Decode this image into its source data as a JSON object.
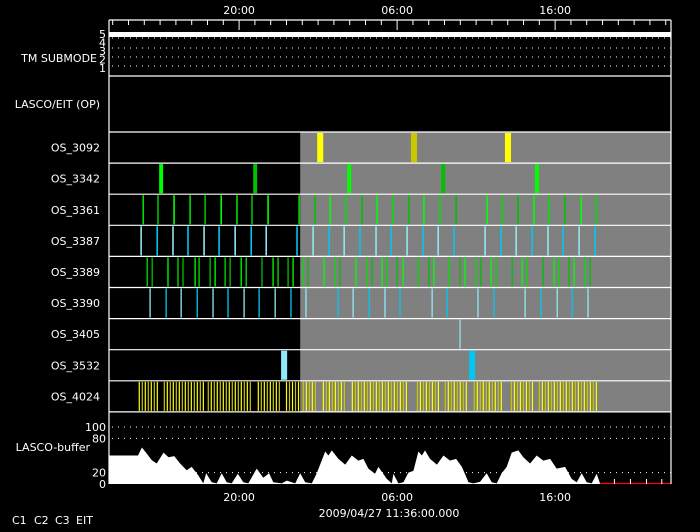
{
  "chart_data": {
    "type": "timeline",
    "axis": {
      "start": "04-26 11:46",
      "end": "04-27 23:20",
      "tick_labels": [
        {
          "t": "04-26 20:00",
          "label": "20:00"
        },
        {
          "t": "04-27 06:00",
          "label": "06:00"
        },
        {
          "t": "04-27 16:00",
          "label": "16:00"
        }
      ],
      "minor_tick_interval": "1 hour"
    },
    "current_time": "2009/04/27 11:36:00.000",
    "shaded_from": "04-26 23:52",
    "shade_color": "#808080",
    "tm_submode": {
      "label": "TM SUBMODE",
      "levels": [
        "5",
        "4",
        "3",
        "2",
        "1"
      ],
      "value": 5
    },
    "lasco_eit": {
      "label": "LASCO/EIT (OP)"
    },
    "rows": [
      {
        "label": "OS_3092",
        "dur": 23,
        "colors": [
          "#ffff00",
          "#c8c800",
          "#ffff00"
        ],
        "times": [
          "04-27 01:08",
          "04-27 07:04",
          "04-27 13:01"
        ]
      },
      {
        "label": "OS_3342",
        "dur": 15,
        "colors": [
          "#00ff00",
          "#00c000"
        ],
        "times": [
          "04-26 15:04",
          "04-26 21:01",
          "04-27 02:58",
          "04-27 08:55",
          "04-27 14:51"
        ]
      },
      {
        "label": "OS_3361",
        "dur": 6,
        "colors": [
          "#00e000",
          "#00c000",
          "#00ff00"
        ],
        "times": [
          "04-26 13:56",
          "04-26 14:52",
          "04-26 15:53",
          "04-26 16:54",
          "04-26 17:51",
          "04-26 18:52",
          "04-26 19:52",
          "04-26 20:49",
          "04-26 21:50",
          "04-26 23:48",
          "04-27 00:49",
          "04-27 01:46",
          "04-27 02:46",
          "04-27 03:47",
          "04-27 04:44",
          "04-27 05:45",
          "04-27 06:45",
          "04-27 07:42",
          "04-27 08:43",
          "04-27 09:44",
          "04-27 11:42",
          "04-27 12:39",
          "04-27 13:39",
          "04-27 14:40",
          "04-27 15:37",
          "04-27 16:38",
          "04-27 17:39",
          "04-27 18:36"
        ]
      },
      {
        "label": "OS_3387",
        "dur": 6,
        "colors": [
          "#90e8f8",
          "#00c8f0"
        ],
        "times": [
          "04-26 13:48",
          "04-26 14:49",
          "04-26 15:49",
          "04-26 16:46",
          "04-26 17:47",
          "04-26 18:44",
          "04-26 19:45",
          "04-26 20:46",
          "04-26 21:43",
          "04-26 23:40",
          "04-27 00:41",
          "04-27 01:42",
          "04-27 02:39",
          "04-27 03:39",
          "04-27 04:40",
          "04-27 05:37",
          "04-27 06:38",
          "04-27 07:39",
          "04-27 08:36",
          "04-27 09:36",
          "04-27 11:34",
          "04-27 12:35",
          "04-27 13:32",
          "04-27 14:33",
          "04-27 15:33",
          "04-27 16:30",
          "04-27 17:31",
          "04-27 18:32"
        ]
      },
      {
        "label": "OS_3389",
        "dur": 5,
        "colors": [
          "#00e000",
          "#00c000",
          "#00ff00"
        ],
        "times": [
          "04-26 14:11",
          "04-26 14:30",
          "04-26 15:30",
          "04-26 16:08",
          "04-26 16:27",
          "04-26 17:13",
          "04-26 17:28",
          "04-26 18:10",
          "04-26 18:29",
          "04-26 19:07",
          "04-26 19:26",
          "04-26 20:08",
          "04-26 20:27",
          "04-26 21:27",
          "04-26 22:09",
          "04-26 22:28",
          "04-26 23:06",
          "04-26 23:25",
          "04-27 00:03",
          "04-27 00:22",
          "04-27 01:23",
          "04-27 02:05",
          "04-27 02:23",
          "04-27 03:24",
          "04-27 04:06",
          "04-27 04:25",
          "04-27 05:03",
          "04-27 05:22",
          "04-27 06:00",
          "04-27 06:23",
          "04-27 07:20",
          "04-27 08:01",
          "04-27 08:20",
          "04-27 09:17",
          "04-27 09:59",
          "04-27 10:18",
          "04-27 11:00",
          "04-27 11:19",
          "04-27 11:57",
          "04-27 12:16",
          "04-27 13:17",
          "04-27 13:55",
          "04-27 14:14",
          "04-27 15:14",
          "04-27 15:56",
          "04-27 16:15",
          "04-27 16:53",
          "04-27 17:12",
          "04-27 17:54",
          "04-27 18:13"
        ]
      },
      {
        "label": "OS_3390",
        "dur": 5,
        "colors": [
          "#90e8f8",
          "#00c8f0"
        ],
        "times": [
          "04-26 14:22",
          "04-26 15:23",
          "04-26 16:20",
          "04-26 17:21",
          "04-26 18:21",
          "04-26 19:18",
          "04-26 20:19",
          "04-26 21:16",
          "04-26 22:17",
          "04-26 23:17",
          "04-27 00:14",
          "04-27 02:16",
          "04-27 03:13",
          "04-27 04:14",
          "04-27 05:14",
          "04-27 06:11",
          "04-27 08:13",
          "04-27 09:10",
          "04-27 11:07",
          "04-27 12:08",
          "04-27 14:06",
          "04-27 15:07",
          "04-27 16:08",
          "04-27 17:05",
          "04-27 18:05"
        ]
      },
      {
        "label": "OS_3405",
        "dur": 4,
        "colors": [
          "#90e8f8"
        ],
        "times": [
          "04-27 09:59"
        ]
      },
      {
        "label": "OS_3532",
        "dur": 23,
        "colors": [
          "#90e8f8",
          "#00c8f0"
        ],
        "times": [
          "04-26 22:51",
          "04-27 10:45"
        ]
      },
      {
        "label": "OS_4024",
        "dur": 3,
        "colors": [
          "#ffff00",
          "#c8c800"
        ],
        "segments": [
          {
            "start": "04-26 13:41",
            "interval_min": 11.4,
            "count": 7
          },
          {
            "start": "04-26 15:16",
            "interval_min": 11.4,
            "count": 14
          },
          {
            "start": "04-26 18:03",
            "interval_min": 11.4,
            "count": 15
          },
          {
            "start": "04-26 21:13",
            "interval_min": 11.4,
            "count": 8
          },
          {
            "start": "04-26 23:00",
            "interval_min": 11.4,
            "count": 5
          },
          {
            "start": "04-27 00:04",
            "interval_min": 11.4,
            "count": 5
          },
          {
            "start": "04-27 01:20",
            "interval_min": 11.4,
            "count": 8
          },
          {
            "start": "04-27 03:10",
            "interval_min": 11.4,
            "count": 19
          },
          {
            "start": "04-27 07:17",
            "interval_min": 11.4,
            "count": 8
          },
          {
            "start": "04-27 09:03",
            "interval_min": 11.4,
            "count": 8
          },
          {
            "start": "04-27 10:53",
            "interval_min": 11.4,
            "count": 10
          },
          {
            "start": "04-27 13:14",
            "interval_min": 11.4,
            "count": 8
          },
          {
            "start": "04-27 15:00",
            "interval_min": 11.4,
            "count": 20
          }
        ]
      }
    ],
    "buffer": {
      "label": "LASCO-buffer",
      "ylim": [
        0,
        100
      ],
      "yticks": [
        "100",
        "80",
        "20",
        "0"
      ],
      "grid_values": [
        100,
        80,
        20
      ],
      "baseline_color": "#ff0000",
      "baseline_from": "04-27 18:51",
      "baseline_ticks": [
        "04-27 19:45",
        "04-27 20:46",
        "04-27 21:47",
        "04-27 22:45"
      ],
      "points": [
        [
          "04-26 11:46",
          50
        ],
        [
          "04-26 13:36",
          50
        ],
        [
          "04-26 13:51",
          64
        ],
        [
          "04-26 14:10",
          53
        ],
        [
          "04-26 14:28",
          42
        ],
        [
          "04-26 14:47",
          36
        ],
        [
          "04-26 15:13",
          55
        ],
        [
          "04-26 15:32",
          47
        ],
        [
          "04-26 15:54",
          49
        ],
        [
          "04-26 16:16",
          36
        ],
        [
          "04-26 16:41",
          24
        ],
        [
          "04-26 17:00",
          30
        ],
        [
          "04-26 17:25",
          15
        ],
        [
          "04-26 17:44",
          1
        ],
        [
          "04-26 17:55",
          19
        ],
        [
          "04-26 18:16",
          3
        ],
        [
          "04-26 18:35",
          1
        ],
        [
          "04-26 18:54",
          19
        ],
        [
          "04-26 19:13",
          3
        ],
        [
          "04-26 19:32",
          1
        ],
        [
          "04-26 19:55",
          18
        ],
        [
          "04-26 20:16",
          3
        ],
        [
          "04-26 20:35",
          1
        ],
        [
          "04-26 21:07",
          27
        ],
        [
          "04-26 21:32",
          11
        ],
        [
          "04-26 21:54",
          19
        ],
        [
          "04-26 22:10",
          3
        ],
        [
          "04-26 22:42",
          1
        ],
        [
          "04-26 23:01",
          6
        ],
        [
          "04-26 23:33",
          1
        ],
        [
          "04-26 23:52",
          19
        ],
        [
          "04-27 00:11",
          3
        ],
        [
          "04-27 00:36",
          1
        ],
        [
          "04-27 00:55",
          19
        ],
        [
          "04-27 01:27",
          57
        ],
        [
          "04-27 01:39",
          50
        ],
        [
          "04-27 01:52",
          59
        ],
        [
          "04-27 02:17",
          44
        ],
        [
          "04-27 02:43",
          34
        ],
        [
          "04-27 03:08",
          50
        ],
        [
          "04-27 03:33",
          41
        ],
        [
          "04-27 03:52",
          44
        ],
        [
          "04-27 04:11",
          27
        ],
        [
          "04-27 04:36",
          18
        ],
        [
          "04-27 04:49",
          30
        ],
        [
          "04-27 05:21",
          9
        ],
        [
          "04-27 05:40",
          1
        ],
        [
          "04-27 05:46",
          18
        ],
        [
          "04-27 06:05",
          1
        ],
        [
          "04-27 06:24",
          3
        ],
        [
          "04-27 06:43",
          20
        ],
        [
          "04-27 07:02",
          23
        ],
        [
          "04-27 07:21",
          57
        ],
        [
          "04-27 07:34",
          50
        ],
        [
          "04-27 07:46",
          59
        ],
        [
          "04-27 08:05",
          44
        ],
        [
          "04-27 08:31",
          34
        ],
        [
          "04-27 08:56",
          50
        ],
        [
          "04-27 09:21",
          41
        ],
        [
          "04-27 09:44",
          44
        ],
        [
          "04-27 10:06",
          30
        ],
        [
          "04-27 10:31",
          3
        ],
        [
          "04-27 10:50",
          1
        ],
        [
          "04-27 11:15",
          4
        ],
        [
          "04-27 11:40",
          19
        ],
        [
          "04-27 11:59",
          3
        ],
        [
          "04-27 12:18",
          1
        ],
        [
          "04-27 12:37",
          19
        ],
        [
          "04-27 12:56",
          30
        ],
        [
          "04-27 13:15",
          55
        ],
        [
          "04-27 13:40",
          59
        ],
        [
          "04-27 13:59",
          47
        ],
        [
          "04-27 14:25",
          36
        ],
        [
          "04-27 14:50",
          50
        ],
        [
          "04-27 15:15",
          41
        ],
        [
          "04-27 15:41",
          44
        ],
        [
          "04-27 16:06",
          27
        ],
        [
          "04-27 16:38",
          30
        ],
        [
          "04-27 17:03",
          9
        ],
        [
          "04-27 17:22",
          3
        ],
        [
          "04-27 17:41",
          19
        ],
        [
          "04-27 18:00",
          3
        ],
        [
          "04-27 18:19",
          1
        ],
        [
          "04-27 18:38",
          18
        ],
        [
          "04-27 18:51",
          0
        ]
      ]
    },
    "legend": [
      {
        "label": "C1",
        "color": "#ff0000"
      },
      {
        "label": "C2",
        "color": "#00ff00"
      },
      {
        "label": "C3",
        "color": "#a0e0f0"
      },
      {
        "label": "EIT",
        "color": "#ffff00"
      }
    ]
  }
}
